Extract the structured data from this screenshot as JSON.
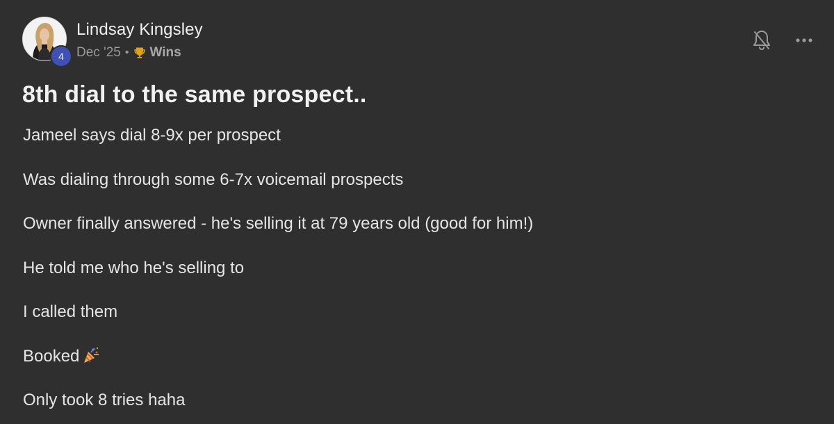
{
  "post": {
    "author": {
      "name": "Lindsay Kingsley",
      "level": "4"
    },
    "meta": {
      "date": "Dec '25",
      "separator": "•",
      "category": "Wins",
      "category_icon": "trophy-icon"
    },
    "title": "8th dial to the same prospect..",
    "paragraphs": [
      "Jameel says dial 8-9x per prospect",
      "Was dialing through some 6-7x voicemail prospects",
      "Owner finally answered - he's selling it at 79 years old (good for him!)",
      "He told me who he's selling to",
      "I called them",
      "Booked",
      "Only took 8 tries haha"
    ],
    "booked_emoji": "party-popper-icon",
    "actions": {
      "notify_icon": "bell-off-icon",
      "more_icon": "more-horizontal-icon"
    }
  },
  "colors": {
    "background": "#2f2f2f",
    "text": "#e7e7e7",
    "muted": "#9a9a9a",
    "badge": "#3f51b5"
  }
}
